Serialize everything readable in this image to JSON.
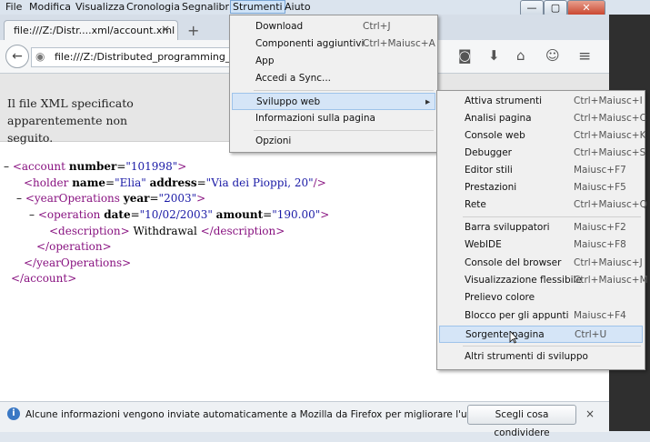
{
  "menubar": {
    "items": [
      "File",
      "Modifica",
      "Visualizza",
      "Cronologia",
      "Segnalibri",
      "Strumenti",
      "Aiuto"
    ]
  },
  "window": {
    "minimize": "—",
    "maximize": "▢",
    "close": "✕"
  },
  "tab": {
    "title": "file:///Z:/Distr....xml/account.xml",
    "close": "×",
    "newtab": "+"
  },
  "urlbar": {
    "value": "file:///Z:/Distributed_programming_II/AA"
  },
  "banner": {
    "text": "Il file XML specificato apparentemente non ha informazioni di stile associate. L'albero del documento è mostrato di seguito.",
    "visible_line1": "Il file XML specificato apparentemente non",
    "visible_line2": "seguito."
  },
  "xml": {
    "lines": [
      {
        "dash": "–",
        "open": "<account",
        "attrs": [
          {
            "n": "number",
            "v": "\"101998\""
          }
        ],
        "close": ">"
      },
      {
        "open": "<holder",
        "attrs": [
          {
            "n": "name",
            "v": "\"Elia\""
          },
          {
            "n": "address",
            "v": "\"Via dei Pioppi, 20\""
          }
        ],
        "close": "/>"
      },
      {
        "dash": "–",
        "open": "<yearOperations",
        "attrs": [
          {
            "n": "year",
            "v": "\"2003\""
          }
        ],
        "close": ">"
      },
      {
        "dash": "–",
        "open": "<operation",
        "attrs": [
          {
            "n": "date",
            "v": "\"10/02/2003\""
          },
          {
            "n": "amount",
            "v": "\"190.00\""
          }
        ],
        "close": ">"
      },
      {
        "open": "<description>",
        "text": " Withdrawal ",
        "end": "</description>"
      },
      {
        "end": "</operation>"
      },
      {
        "end": "</yearOperations>"
      },
      {
        "end": "</account>"
      }
    ]
  },
  "strumenti_menu": {
    "items": [
      {
        "label": "Download",
        "shortcut": "Ctrl+J"
      },
      {
        "label": "Componenti aggiuntivi",
        "shortcut": "Ctrl+Maiusc+A"
      },
      {
        "label": "App",
        "shortcut": ""
      },
      {
        "label": "Accedi a Sync...",
        "shortcut": ""
      },
      {
        "label": "Sviluppo web",
        "shortcut": "▸"
      },
      {
        "label": "Informazioni sulla pagina",
        "shortcut": ""
      },
      {
        "label": "Opzioni",
        "shortcut": ""
      }
    ]
  },
  "sviluppo_menu": {
    "items": [
      {
        "label": "Attiva strumenti",
        "shortcut": "Ctrl+Maiusc+I"
      },
      {
        "label": "Analisi pagina",
        "shortcut": "Ctrl+Maiusc+C"
      },
      {
        "label": "Console web",
        "shortcut": "Ctrl+Maiusc+K"
      },
      {
        "label": "Debugger",
        "shortcut": "Ctrl+Maiusc+S"
      },
      {
        "label": "Editor stili",
        "shortcut": "Maiusc+F7"
      },
      {
        "label": "Prestazioni",
        "shortcut": "Maiusc+F5"
      },
      {
        "label": "Rete",
        "shortcut": "Ctrl+Maiusc+Q"
      },
      {
        "label": "Barra sviluppatori",
        "shortcut": "Maiusc+F2"
      },
      {
        "label": "WebIDE",
        "shortcut": "Maiusc+F8"
      },
      {
        "label": "Console del browser",
        "shortcut": "Ctrl+Maiusc+J"
      },
      {
        "label": "Visualizzazione flessibile",
        "shortcut": "Ctrl+Maiusc+M"
      },
      {
        "label": "Prelievo colore",
        "shortcut": ""
      },
      {
        "label": "Blocco per gli appunti",
        "shortcut": "Maiusc+F4"
      },
      {
        "label": "Sorgente pagina",
        "shortcut": "Ctrl+U"
      },
      {
        "label": "Altri strumenti di sviluppo",
        "shortcut": ""
      }
    ]
  },
  "notification": {
    "icon": "i",
    "text": "Alcune informazioni vengono inviate automaticamente a Mozilla da Firefox per migliorare l'utilizzo.",
    "button": "Scegli cosa condividere",
    "close": "×"
  },
  "icons": {
    "back": "←",
    "globe": "◉",
    "pocket": "◙",
    "download": "⬇",
    "home": "⌂",
    "chat": "☺",
    "menu": "≡"
  }
}
